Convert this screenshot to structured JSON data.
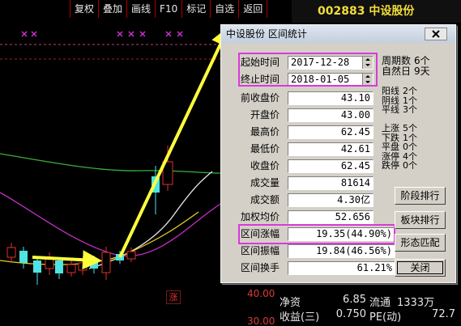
{
  "toolbar": {
    "items": [
      "复权",
      "叠加",
      "画线",
      "F10",
      "标记",
      "自选",
      "返回"
    ]
  },
  "stock_title": "002883 中设股份",
  "chart": {
    "price_labels": [
      "40.00",
      "30.00"
    ],
    "badge": "涨"
  },
  "dialog": {
    "title": "中设股份 区间统计",
    "close_icon": "close-icon",
    "start_label": "起始时间",
    "start_value": "2017-12-28",
    "end_label": "终止时间",
    "end_value": "2018-01-05",
    "periods_label": "周期数",
    "periods_value": "6个",
    "days_label": "自然日",
    "days_value": "9天",
    "stats": [
      {
        "label": "前收盘价",
        "value": "43.10"
      },
      {
        "label": "开盘价",
        "value": "43.00"
      },
      {
        "label": "最高价",
        "value": "62.45"
      },
      {
        "label": "最低价",
        "value": "42.61"
      },
      {
        "label": "收盘价",
        "value": "62.45"
      },
      {
        "label": "成交量",
        "value": "81614"
      },
      {
        "label": "成交额",
        "value": "4.30亿"
      },
      {
        "label": "加权均价",
        "value": "52.656"
      },
      {
        "label": "区间涨幅",
        "value": "19.35(44.90%)"
      },
      {
        "label": "区间振幅",
        "value": "19.84(46.56%)"
      },
      {
        "label": "区间换手",
        "value": "61.21%"
      }
    ],
    "candle_counts": [
      {
        "label": "阳线",
        "value": "2个"
      },
      {
        "label": "阴线",
        "value": "1个"
      },
      {
        "label": "平线",
        "value": "3个"
      }
    ],
    "move_counts": [
      {
        "label": "上涨",
        "value": "5个"
      },
      {
        "label": "下跌",
        "value": "1个"
      },
      {
        "label": "平盘",
        "value": "0个"
      },
      {
        "label": "涨停",
        "value": "4个"
      },
      {
        "label": "跌停",
        "value": "0个"
      }
    ],
    "buttons": [
      "阶段排行",
      "板块排行",
      "形态匹配",
      "关闭"
    ]
  },
  "info_panel": {
    "net_asset_label": "净资",
    "net_asset_value": "6.85",
    "float_label": "流通",
    "float_value": "1333万",
    "eps_label": "收益(三)",
    "eps_value": "0.750",
    "pe_label": "PE(动)",
    "pe_value": "72.7"
  },
  "colors": {
    "highlight": "#d93ad9",
    "arrow": "#ffff3c",
    "title": "#f2dc3a",
    "up": "#e03030",
    "down": "#4fe3e3"
  }
}
